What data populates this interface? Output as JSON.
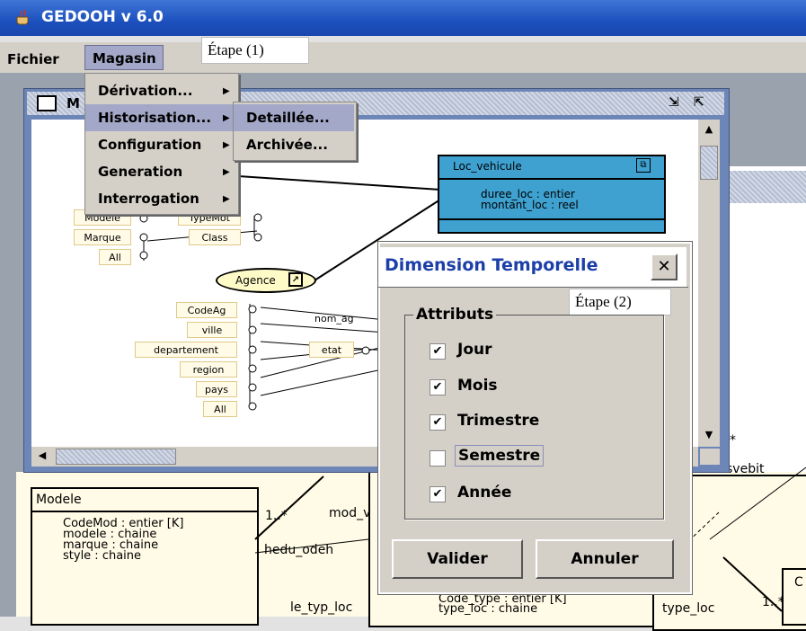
{
  "app": {
    "title": "GEDOOH v 6.0",
    "icon": "java-cup-icon"
  },
  "menubar": {
    "file": "Fichier",
    "magasin": "Magasin"
  },
  "annotations": {
    "step1": "Étape (1)",
    "step2": "Étape (2)"
  },
  "inner_window": {
    "title_fragment": "M"
  },
  "magasin_menu": {
    "items": [
      "Dérivation...",
      "Historisation...",
      "Configuration",
      "Generation",
      "Interrogation"
    ],
    "highlighted": "Historisation..."
  },
  "submenu": {
    "items": [
      "Detaillée...",
      "Archivée..."
    ],
    "highlighted": "Detaillée..."
  },
  "diagram": {
    "loc_vehicule": {
      "name": "Loc_vehicule",
      "attrs": [
        "duree_loc : entier",
        "montant_loc : reel"
      ]
    },
    "agence": "Agence",
    "left_levels": [
      "Modele",
      "Marque",
      "All"
    ],
    "typemot": [
      "TypeMot",
      "Class"
    ],
    "geo_levels": [
      "CodeAg",
      "ville",
      "departement",
      "region",
      "pays",
      "All"
    ],
    "labels": {
      "nom_ag": "nom_ag",
      "etat": "etat"
    }
  },
  "background": {
    "modele": {
      "name": "Modele",
      "attrs": [
        "CodeMod : entier  [K]",
        "modele : chaine",
        "marque : chaine",
        "style : chaine"
      ]
    },
    "labels": {
      "mod": "mod_v",
      "heq": "hedu_odeh",
      "le_typ_loc": "le_typ_loc",
      "code_type": "Code_type : entier  [K]",
      "type_loc": "type_loc : chaine",
      "type_loc2": "type_loc",
      "svebit": "svebit",
      "mult1": "1..*",
      "mult2": "1..*",
      "star": "*",
      "c": "C"
    }
  },
  "dialog": {
    "title": "Dimension Temporelle",
    "group_label": "Attributs",
    "options": [
      {
        "label": "Jour",
        "checked": true
      },
      {
        "label": "Mois",
        "checked": true
      },
      {
        "label": "Trimestre",
        "checked": true
      },
      {
        "label": "Semestre",
        "checked": false
      },
      {
        "label": "Année",
        "checked": true
      }
    ],
    "ok": "Valider",
    "cancel": "Annuler",
    "close": "✕"
  }
}
